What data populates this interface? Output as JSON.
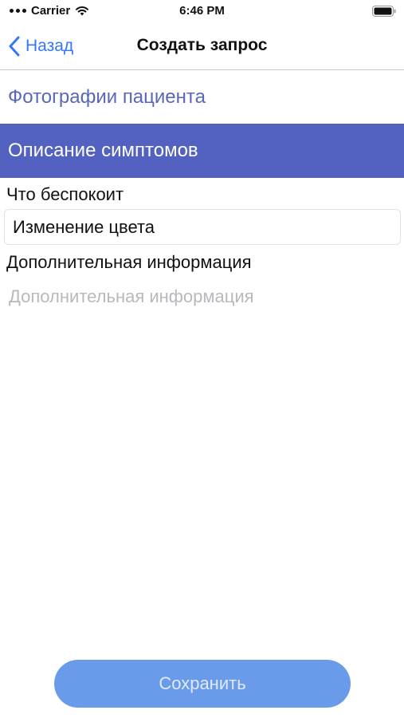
{
  "status_bar": {
    "carrier": "Carrier",
    "time": "6:46 PM"
  },
  "nav": {
    "back_label": "Назад",
    "title": "Создать запрос"
  },
  "sections": {
    "photos_label": "Фотографии пациента",
    "symptoms_label": "Описание симптомов"
  },
  "form": {
    "concern_label": "Что беспокоит",
    "concern_value": "Изменение цвета",
    "additional_label": "Дополнительная информация",
    "additional_placeholder": "Дополнительная информация",
    "additional_value": ""
  },
  "actions": {
    "save_label": "Сохранить"
  },
  "colors": {
    "accent": "#3478f6",
    "section_header": "#5361c0",
    "section_text": "#5a67b8",
    "save_button": "#6a9bea"
  },
  "icons": {
    "back": "chevron-left-icon",
    "wifi": "wifi-icon",
    "battery": "battery-icon",
    "signal": "signal-icon"
  }
}
